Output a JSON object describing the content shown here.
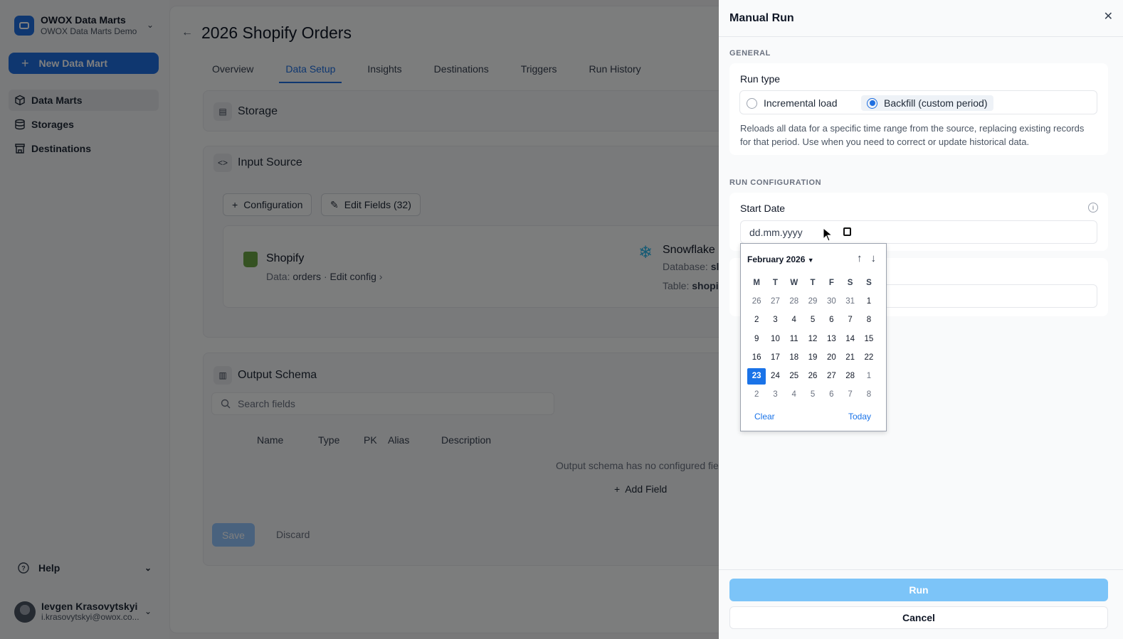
{
  "workspace": {
    "name": "OWOX Data Marts",
    "subtitle": "OWOX Data Marts Demo"
  },
  "sidebar": {
    "new_button": "New Data Mart",
    "items": [
      {
        "label": "Data Marts",
        "icon": "cube-icon"
      },
      {
        "label": "Storages",
        "icon": "database-icon"
      },
      {
        "label": "Destinations",
        "icon": "store-icon"
      }
    ],
    "help": "Help",
    "user": {
      "name": "Ievgen Krasovytskyi",
      "email": "i.krasovytskyi@owox.co..."
    }
  },
  "page": {
    "title": "2026 Shopify Orders",
    "tabs": [
      "Overview",
      "Data Setup",
      "Insights",
      "Destinations",
      "Triggers",
      "Run History"
    ],
    "active_tab": "Data Setup"
  },
  "storage": {
    "title": "Storage"
  },
  "input_source": {
    "title": "Input Source",
    "configuration_btn": "Configuration",
    "edit_fields_btn": "Edit Fields (32)",
    "source_name": "Shopify",
    "data_label": "Data:",
    "data_value": "orders",
    "edit_config": "Edit config",
    "dest_name": "Snowflake",
    "database_label": "Database:",
    "database_value": "sl",
    "table_label": "Table:",
    "table_value": "shopi"
  },
  "output_schema": {
    "title": "Output Schema",
    "search_placeholder": "Search fields",
    "columns": [
      "Name",
      "Type",
      "PK",
      "Alias",
      "Description"
    ],
    "empty": "Output schema has no configured fiel",
    "add_field": "Add Field",
    "save": "Save",
    "discard": "Discard"
  },
  "drawer": {
    "title": "Manual Run",
    "general_label": "GENERAL",
    "run_type_label": "Run type",
    "options": [
      "Incremental load",
      "Backfill (custom period)"
    ],
    "selected_option": "Backfill (custom period)",
    "description": "Reloads all data for a specific time range from the source, replacing existing records for that period. Use when you need to correct or update historical data.",
    "run_config_label": "RUN CONFIGURATION",
    "start_date_label": "Start Date",
    "start_date_placeholder": "dd.mm.yyyy",
    "run_btn": "Run",
    "cancel_btn": "Cancel"
  },
  "datepicker": {
    "month": "February 2026",
    "weekdays": [
      "M",
      "T",
      "W",
      "T",
      "F",
      "S",
      "S"
    ],
    "weeks": [
      [
        "26",
        "27",
        "28",
        "29",
        "30",
        "31",
        "1"
      ],
      [
        "2",
        "3",
        "4",
        "5",
        "6",
        "7",
        "8"
      ],
      [
        "9",
        "10",
        "11",
        "12",
        "13",
        "14",
        "15"
      ],
      [
        "16",
        "17",
        "18",
        "19",
        "20",
        "21",
        "22"
      ],
      [
        "23",
        "24",
        "25",
        "26",
        "27",
        "28",
        "1"
      ],
      [
        "2",
        "3",
        "4",
        "5",
        "6",
        "7",
        "8"
      ]
    ],
    "selected": "23",
    "clear": "Clear",
    "today": "Today"
  },
  "colors": {
    "accent": "#1f6fe0",
    "selected_day": "#1a73e8",
    "run_button": "#7cc4f8"
  }
}
